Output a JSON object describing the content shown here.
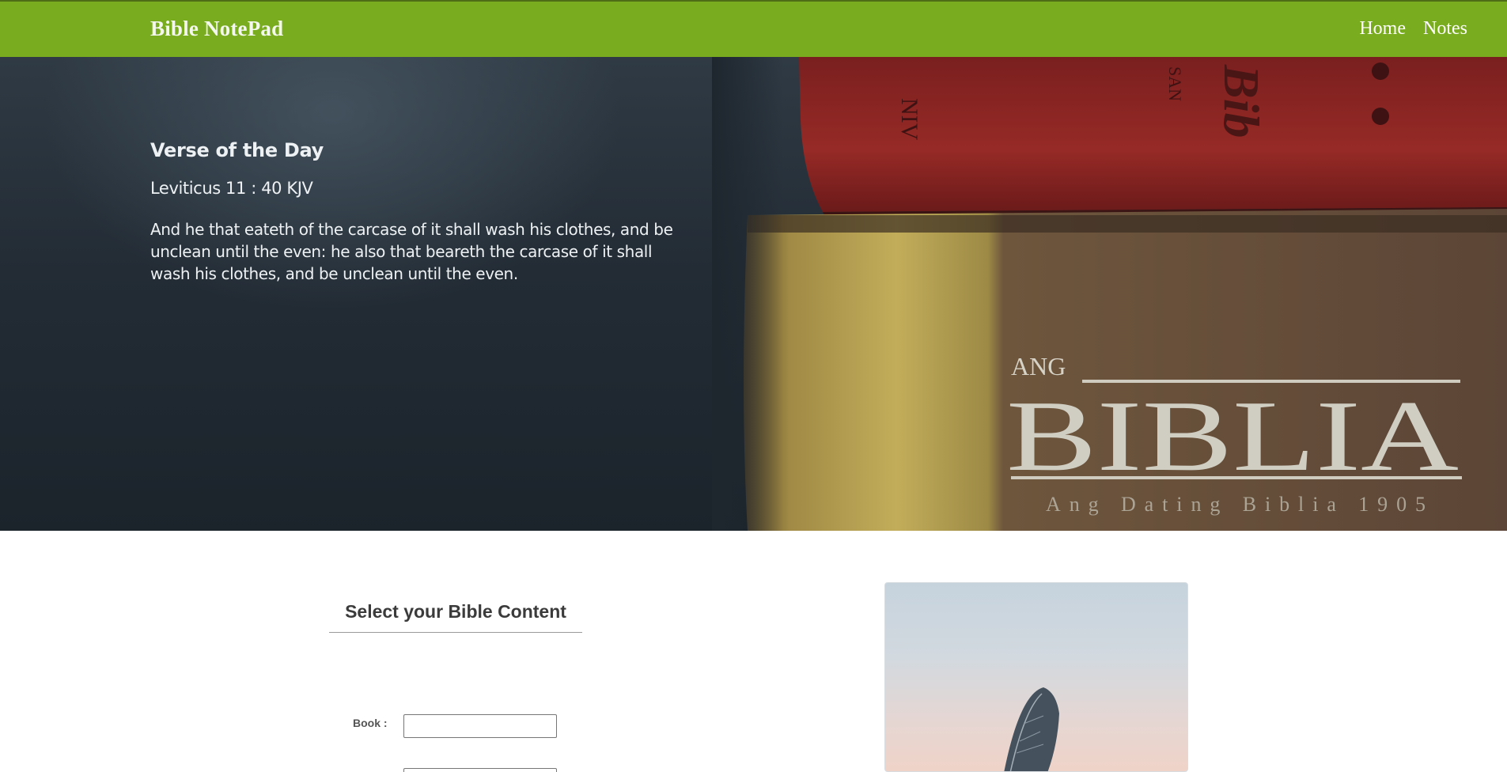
{
  "header": {
    "brand": "Bible NotePad",
    "nav": [
      {
        "label": "Home"
      },
      {
        "label": "Notes"
      }
    ],
    "color": "#79ad1f"
  },
  "hero": {
    "heading": "Verse of the Day",
    "reference": "Leviticus 11 : 40 KJV",
    "verse": "And he that eateth of the carcase of it shall wash his clothes, and be unclean until the even: he also that beareth the carcase of it shall wash his clothes, and be unclean until the even.",
    "image_text": {
      "top_spine": [
        "NIV",
        "SAN",
        "Bib"
      ],
      "ang": "ANG",
      "biblia": "BIBLIA",
      "edition": "Ang Dating Biblia 1905"
    }
  },
  "content": {
    "title": "Select your Bible Content",
    "book_label": "Book :",
    "book_value": ""
  }
}
